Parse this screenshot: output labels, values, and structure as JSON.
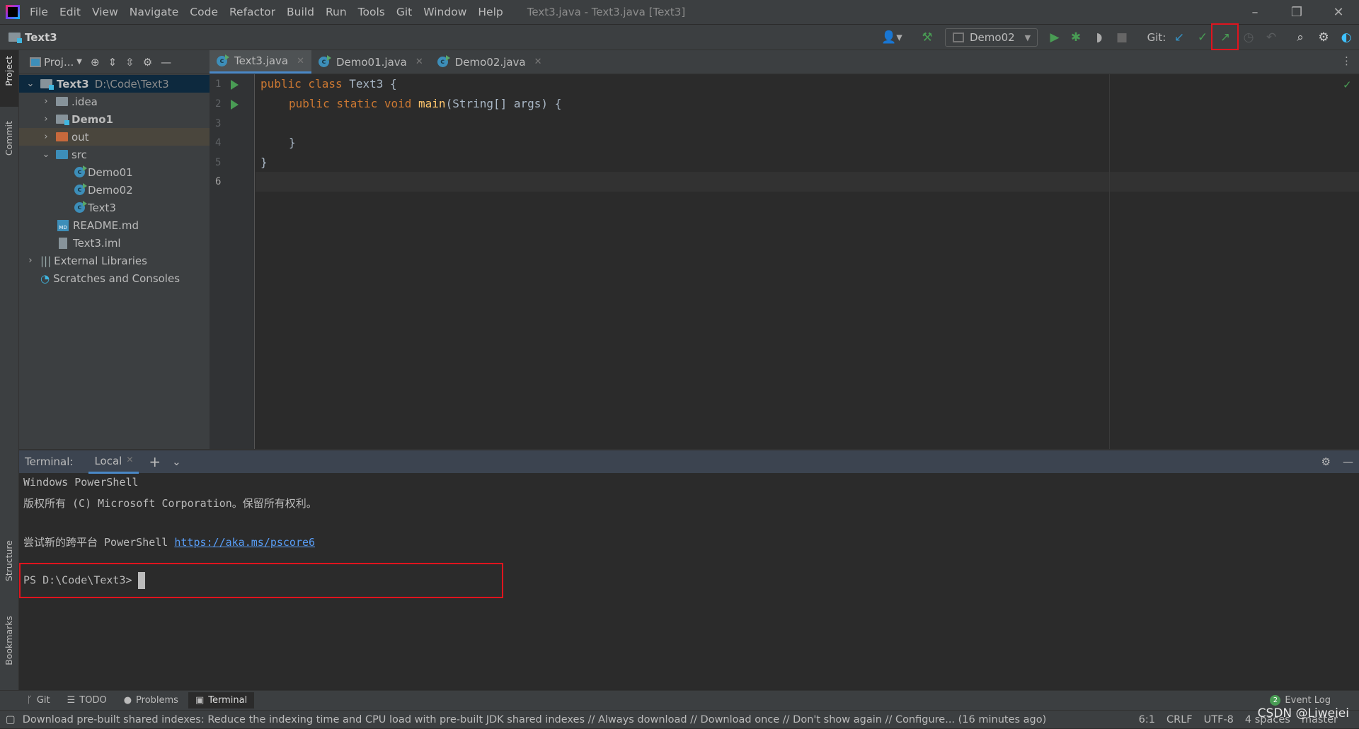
{
  "menubar": {
    "items": [
      "File",
      "Edit",
      "View",
      "Navigate",
      "Code",
      "Refactor",
      "Build",
      "Run",
      "Tools",
      "Git",
      "Window",
      "Help"
    ],
    "window_title": "Text3.java - Text3.java [Text3]"
  },
  "navbar": {
    "project": "Text3",
    "run_config": "Demo02",
    "git_label": "Git:"
  },
  "project_panel": {
    "title": "Proj...",
    "tree": [
      {
        "label": "Text3",
        "hint": "D:\\Code\\Text3"
      },
      {
        "label": ".idea"
      },
      {
        "label": "Demo1"
      },
      {
        "label": "out"
      },
      {
        "label": "src"
      },
      {
        "label": "Demo01"
      },
      {
        "label": "Demo02"
      },
      {
        "label": "Text3"
      },
      {
        "label": "README.md"
      },
      {
        "label": "Text3.iml"
      },
      {
        "label": "External Libraries"
      },
      {
        "label": "Scratches and Consoles"
      }
    ]
  },
  "side_labels": {
    "project": "Project",
    "commit": "Commit",
    "structure": "Structure",
    "bookmarks": "Bookmarks"
  },
  "editor": {
    "tabs": [
      "Text3.java",
      "Demo01.java",
      "Demo02.java"
    ],
    "active_tab": "Text3.java",
    "line_numbers": [
      "1",
      "2",
      "3",
      "4",
      "5",
      "6"
    ],
    "code": {
      "l1_kw": "public class",
      "l1_rest": " Text3 {",
      "l2_kw": "public static void",
      "l2_fn": "main",
      "l2_rest": "(String[] args) {",
      "l4": "}",
      "l5": "}"
    }
  },
  "terminal": {
    "label": "Terminal:",
    "tab": "Local",
    "lines": [
      "Windows PowerShell",
      "版权所有 (C) Microsoft Corporation。保留所有权利。",
      "尝试新的跨平台 PowerShell "
    ],
    "link": "https://aka.ms/pscore6",
    "prompt": "PS D:\\Code\\Text3>"
  },
  "bottom_tools": [
    "Git",
    "TODO",
    "Problems",
    "Terminal"
  ],
  "event_log": {
    "count": "2",
    "label": "Event Log"
  },
  "status": {
    "message": "Download pre-built shared indexes: Reduce the indexing time and CPU load with pre-built JDK shared indexes // Always download // Download once // Don't show again // Configure... (16 minutes ago)",
    "position": "6:1",
    "line_sep": "CRLF",
    "encoding": "UTF-8",
    "indent": "4 spaces",
    "branch": "master",
    "watermark": "CSDN @Liweiei"
  },
  "colors": {
    "accent": "#4a88c7",
    "highlight_box": "#e0141e",
    "keyword": "#cc7832",
    "function": "#ffc66d"
  }
}
